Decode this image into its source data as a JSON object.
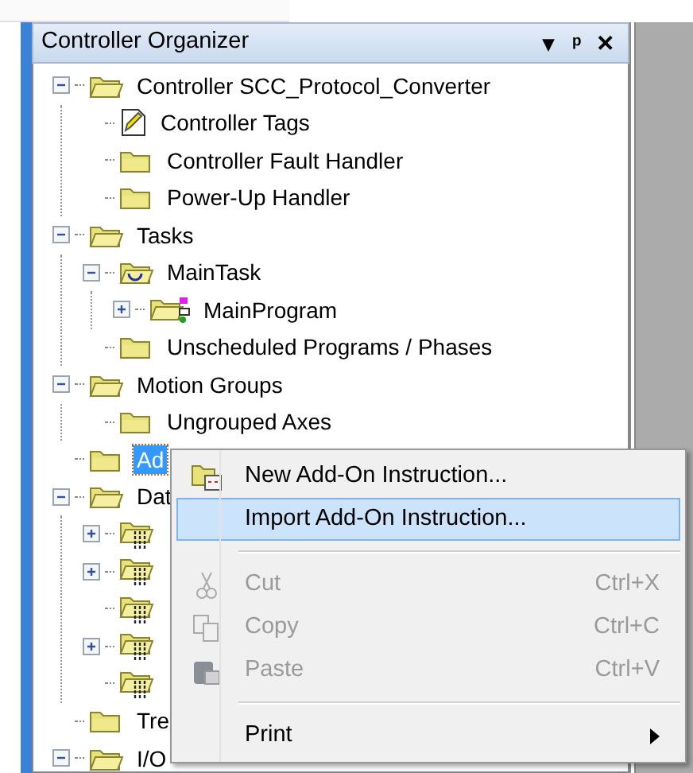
{
  "panel": {
    "title": "Controller Organizer",
    "buttons": [
      "▾",
      "ᵖ",
      "✕"
    ]
  },
  "tree": [
    {
      "label": "Controller SCC_Protocol_Converter",
      "kind": "openfolder",
      "expanded": true,
      "selected": false,
      "children": [
        {
          "label": "Controller Tags",
          "kind": "tags",
          "selected": false
        },
        {
          "label": "Controller Fault Handler",
          "kind": "folder",
          "selected": false
        },
        {
          "label": "Power-Up Handler",
          "kind": "folder",
          "selected": false
        }
      ]
    },
    {
      "label": "Tasks",
      "kind": "openfolder",
      "expanded": true,
      "selected": false,
      "children": [
        {
          "label": "MainTask",
          "kind": "task",
          "expanded": true,
          "selected": false,
          "children": [
            {
              "label": "MainProgram",
              "kind": "program",
              "expanded": false,
              "selected": false
            }
          ]
        },
        {
          "label": "Unscheduled Programs / Phases",
          "kind": "folder",
          "selected": false
        }
      ]
    },
    {
      "label": "Motion Groups",
      "kind": "openfolder",
      "expanded": true,
      "selected": false,
      "children": [
        {
          "label": "Ungrouped Axes",
          "kind": "folder",
          "selected": false
        }
      ]
    },
    {
      "label": "Ad",
      "kind": "folder",
      "selected": true
    },
    {
      "label": "Dat",
      "kind": "openfolder",
      "expanded": true,
      "selected": false,
      "children": [
        {
          "kind": "data",
          "expanded": false
        },
        {
          "kind": "data",
          "expanded": false
        },
        {
          "kind": "data"
        },
        {
          "kind": "data",
          "expanded": false
        },
        {
          "kind": "data"
        }
      ]
    },
    {
      "label": "Tre",
      "kind": "folder",
      "selected": false
    },
    {
      "label": "I/O",
      "kind": "openfolder",
      "expanded": true,
      "selected": false
    }
  ],
  "context_menu": [
    {
      "kind": "create",
      "label": "New Add-On Instruction...",
      "selected": false,
      "disabled": false
    },
    {
      "kind": "plain",
      "label": "Import Add-On Instruction...",
      "selected": true,
      "disabled": false
    },
    {
      "kind": "separator"
    },
    {
      "kind": "cut",
      "label": "Cut",
      "shortcut": "Ctrl+X",
      "selected": false,
      "disabled": true
    },
    {
      "kind": "copy",
      "label": "Copy",
      "shortcut": "Ctrl+C",
      "selected": false,
      "disabled": true
    },
    {
      "kind": "paste",
      "label": "Paste",
      "shortcut": "Ctrl+V",
      "selected": false,
      "disabled": true
    },
    {
      "kind": "separator"
    },
    {
      "kind": "submenu",
      "label": "Print",
      "selected": false,
      "disabled": false
    }
  ]
}
